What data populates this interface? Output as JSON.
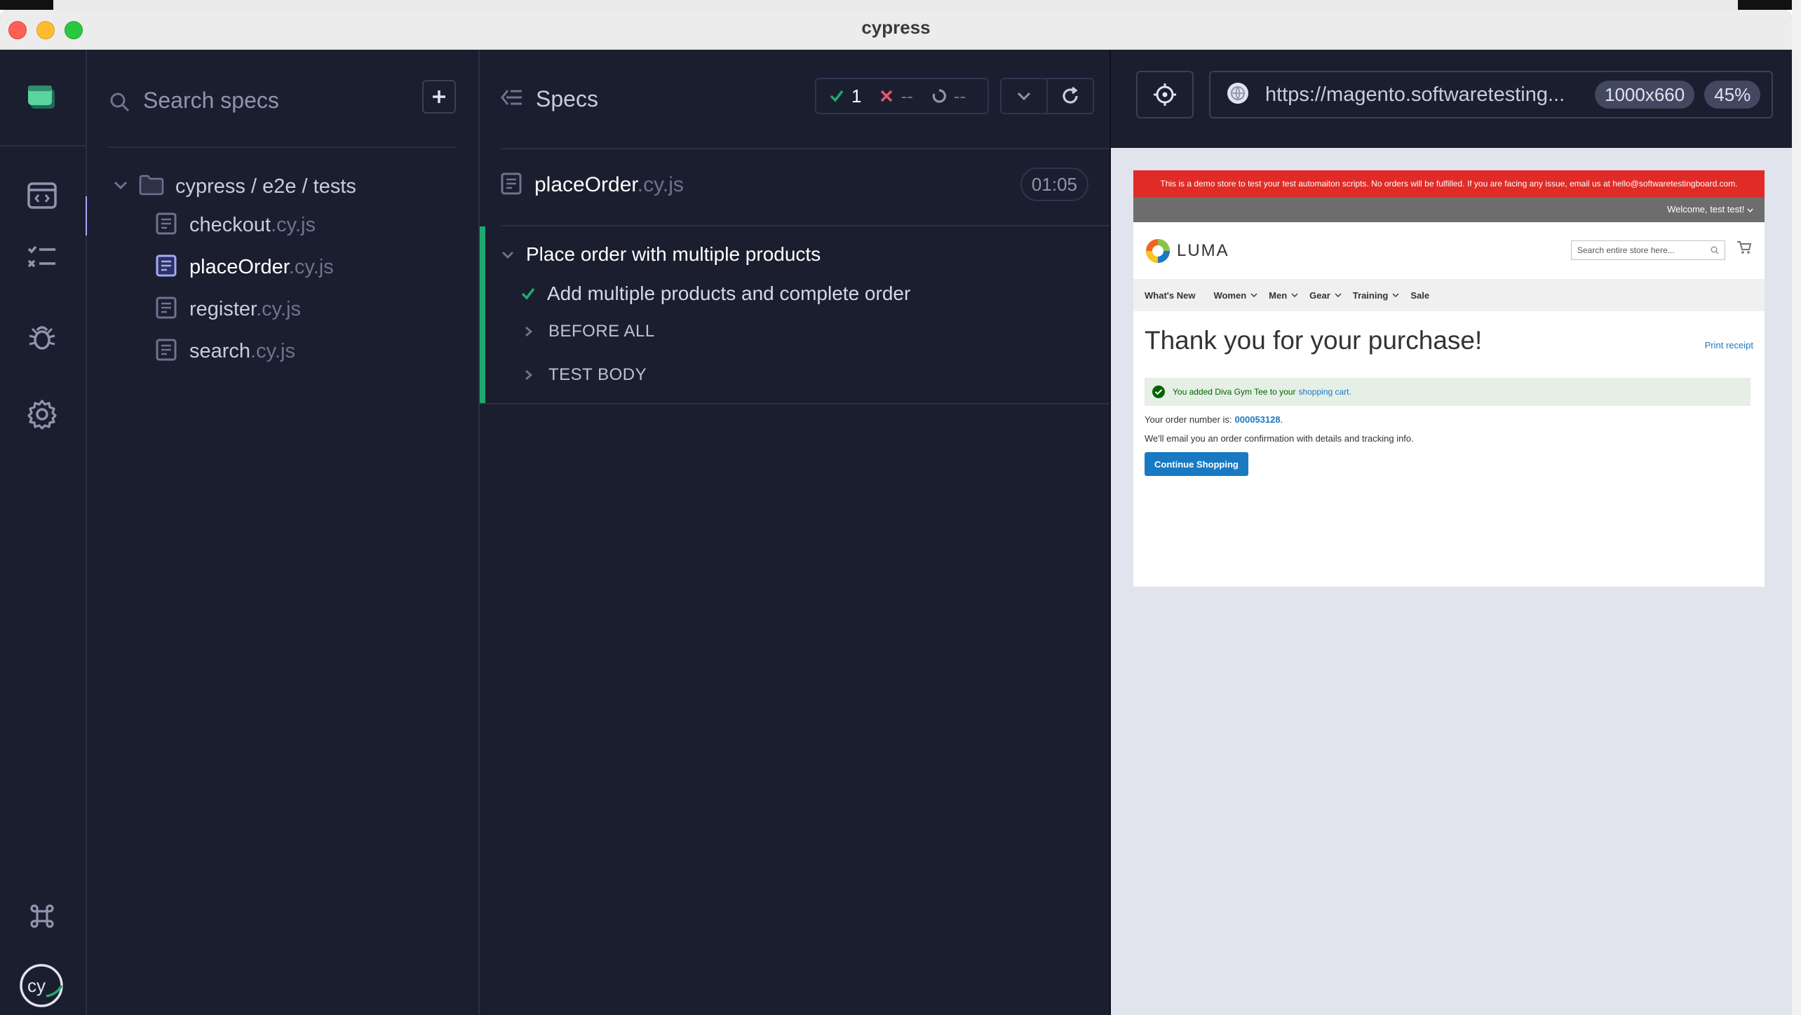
{
  "window": {
    "title": "cypress"
  },
  "specs_panel": {
    "search_placeholder": "Search specs",
    "folder": "cypress / e2e / tests",
    "specs": [
      {
        "name": "checkout",
        "ext": ".cy.js",
        "active": false
      },
      {
        "name": "placeOrder",
        "ext": ".cy.js",
        "active": true
      },
      {
        "name": "register",
        "ext": ".cy.js",
        "active": false
      },
      {
        "name": "search",
        "ext": ".cy.js",
        "active": false
      }
    ]
  },
  "reporter": {
    "specs_label": "Specs",
    "stats": {
      "passed": "1",
      "failed": "--",
      "pending": "--"
    },
    "file": {
      "name": "placeOrder",
      "ext": ".cy.js",
      "duration": "01:05"
    },
    "suite_title": "Place order with multiple products",
    "test_title": "Add multiple products and complete order",
    "hooks": [
      "BEFORE ALL",
      "TEST BODY"
    ]
  },
  "aut": {
    "url": "https://magento.softwaretesting...",
    "viewport": "1000x660",
    "zoom": "45%",
    "page": {
      "banner": "This is a demo store to test your test automaiton scripts. No orders will be fulfilled. If you are facing any issue, email us at hello@softwaretestingboard.com.",
      "welcome": "Welcome, test test!",
      "logo": "LUMA",
      "search_placeholder": "Search entire store here...",
      "nav": [
        "What's New",
        "Women",
        "Men",
        "Gear",
        "Training",
        "Sale"
      ],
      "heading": "Thank you for your purchase!",
      "print_receipt": "Print receipt",
      "success_prefix": "You added Diva Gym Tee to your",
      "success_link": "shopping cart.",
      "order_prefix": "Your order number is:",
      "order_number": "000053128",
      "order_suffix": ".",
      "email_line": "We'll email you an order confirmation with details and tracking info.",
      "continue_button": "Continue Shopping"
    }
  },
  "colors": {
    "pass": "#1fa971",
    "fail": "#e45770",
    "accent": "#a3a8f8",
    "banner": "#e02b27",
    "link": "#1979c3"
  }
}
